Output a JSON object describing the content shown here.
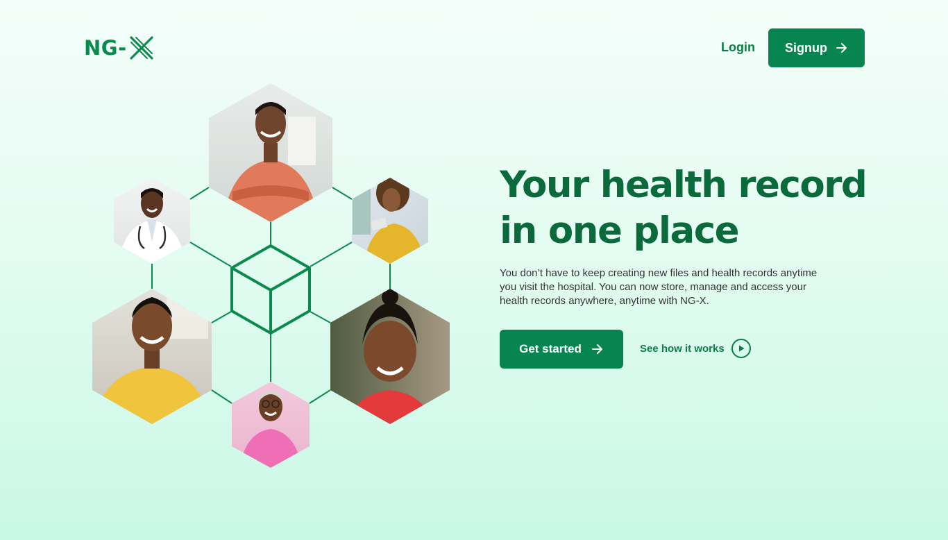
{
  "brand": {
    "logo_text": "NG-",
    "accent_color": "#078550",
    "headline_color": "#0a6a3c"
  },
  "nav": {
    "login_label": "Login",
    "signup_label": "Signup",
    "signup_icon": "arrow-right-icon"
  },
  "hero": {
    "headline": "Your health record in one place",
    "subtext": "You don’t have to keep creating  new files and health records anytime you visit the hospital. You can now store, manage and access your health records anywhere, anytime with NG-X.",
    "primary_cta_label": "Get started",
    "primary_cta_icon": "arrow-right-icon",
    "secondary_cta_label": "See how it works",
    "secondary_cta_icon": "play-circle-icon"
  },
  "illustration": {
    "center_icon": "cube-icon",
    "photos": [
      "man-orange-shirt-photo",
      "doctor-photo",
      "woman-phone-photo",
      "woman-yellow-top-photo",
      "girl-red-dress-photo",
      "older-woman-pink-photo"
    ]
  }
}
